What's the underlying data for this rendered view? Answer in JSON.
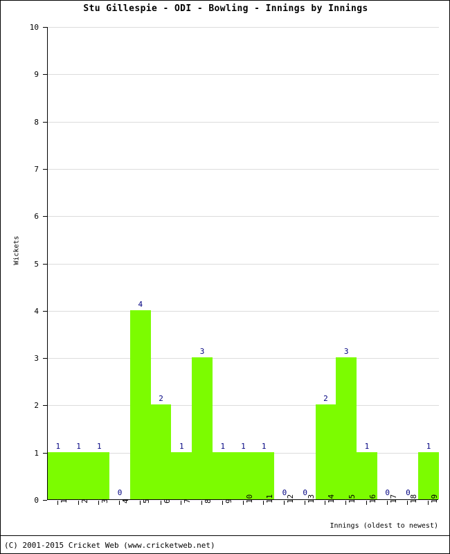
{
  "chart_data": {
    "type": "bar",
    "title": "Stu Gillespie - ODI - Bowling - Innings by Innings",
    "xlabel": "Innings (oldest to newest)",
    "ylabel": "Wickets",
    "categories": [
      "1",
      "2",
      "3",
      "4",
      "5",
      "6",
      "7",
      "8",
      "9",
      "10",
      "11",
      "12",
      "13",
      "14",
      "15",
      "16",
      "17",
      "18",
      "19"
    ],
    "values": [
      1,
      1,
      1,
      0,
      4,
      2,
      1,
      3,
      1,
      1,
      1,
      0,
      0,
      2,
      3,
      1,
      0,
      0,
      1
    ],
    "value_labels": [
      "1",
      "1",
      "1",
      "0",
      "4",
      "2",
      "1",
      "3",
      "1",
      "1",
      "1",
      "0",
      "0",
      "2",
      "3",
      "1",
      "0",
      "0",
      "1"
    ],
    "ylim": [
      0,
      10
    ],
    "ytick_labels": [
      "0",
      "1",
      "2",
      "3",
      "4",
      "5",
      "6",
      "7",
      "8",
      "9",
      "10"
    ],
    "ytick_values": [
      0,
      1,
      2,
      3,
      4,
      5,
      6,
      7,
      8,
      9,
      10
    ],
    "grid": true,
    "legend": null,
    "bar_color": "#7cfc00",
    "label_color": "#000080",
    "grid_color": "#dcdcdc",
    "axis_color": "#000000"
  },
  "footer": {
    "copyright": "(C) 2001-2015 Cricket Web (www.cricketweb.net)"
  }
}
